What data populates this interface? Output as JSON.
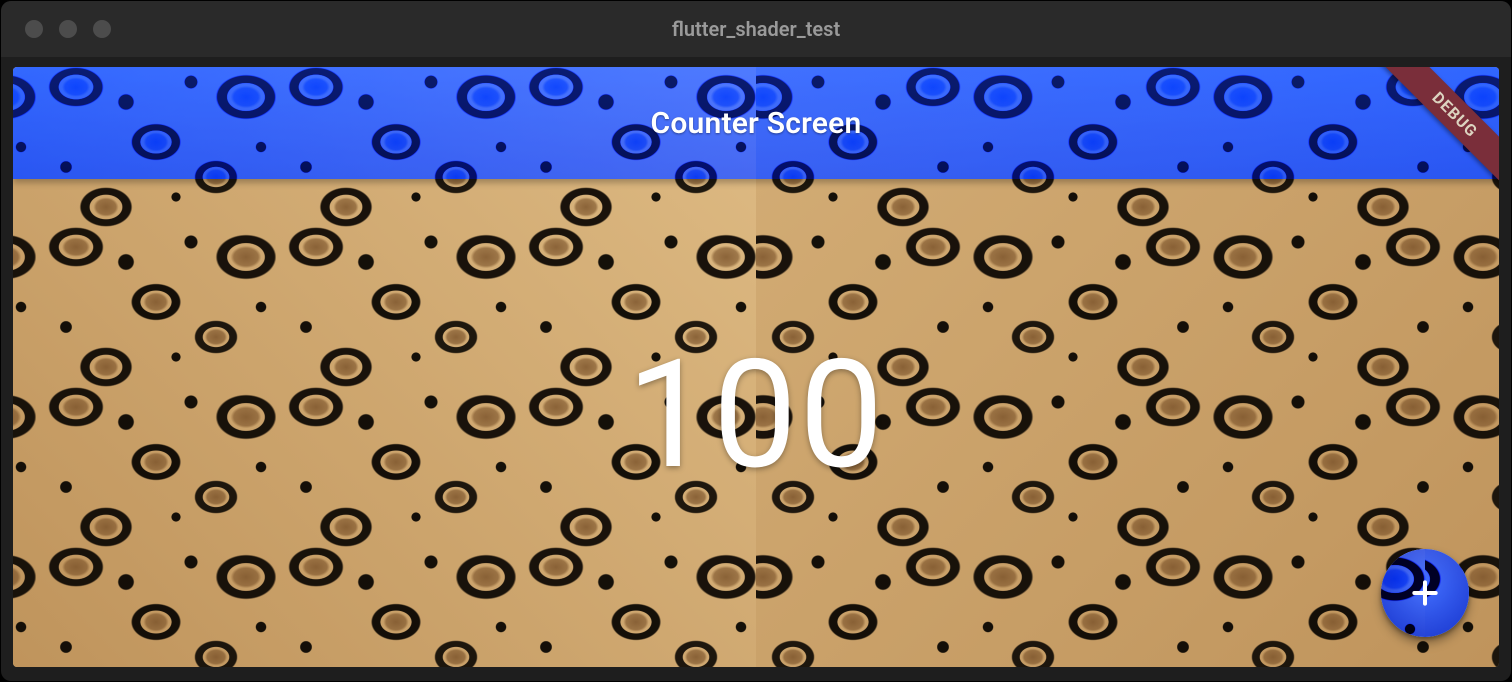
{
  "window": {
    "title": "flutter_shader_test"
  },
  "appbar": {
    "title": "Counter Screen"
  },
  "counter": {
    "value": "100"
  },
  "debug_banner": {
    "label": "DEBUG"
  },
  "fab": {
    "icon": "plus-icon",
    "aria_label": "Increment"
  },
  "colors": {
    "accent_blue": "#0a3cff",
    "banner_bg": "#7a2e3a",
    "leopard_base": "#cda46a"
  }
}
